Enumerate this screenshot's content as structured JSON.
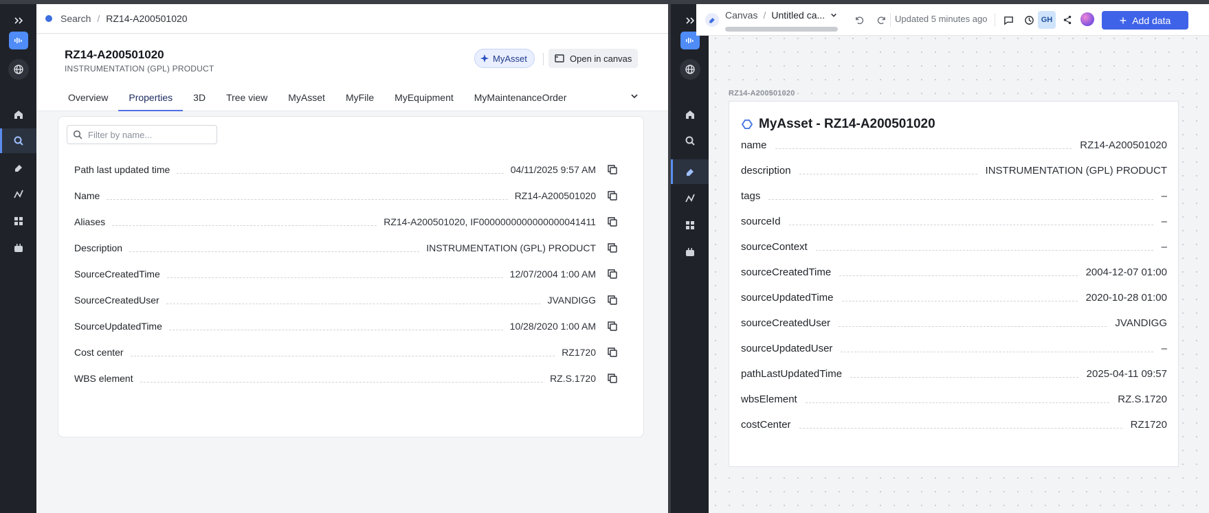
{
  "left": {
    "breadcrumb": {
      "root": "Search",
      "current": "RZ14-A200501020"
    },
    "asset": {
      "title": "RZ14-A200501020",
      "subtitle": "INSTRUMENTATION (GPL) PRODUCT"
    },
    "chip_label": "MyAsset",
    "open_canvas_label": "Open in canvas",
    "tabs": [
      "Overview",
      "Properties",
      "3D",
      "Tree view",
      "MyAsset",
      "MyFile",
      "MyEquipment",
      "MyMaintenanceOrder"
    ],
    "active_tab": "Properties",
    "filter_placeholder": "Filter by name...",
    "properties": [
      {
        "label": "Path last updated time",
        "value": "04/11/2025 9:57 AM"
      },
      {
        "label": "Name",
        "value": "RZ14-A200501020"
      },
      {
        "label": "Aliases",
        "value": "RZ14-A200501020, IF0000000000000000041411"
      },
      {
        "label": "Description",
        "value": "INSTRUMENTATION (GPL) PRODUCT"
      },
      {
        "label": "SourceCreatedTime",
        "value": "12/07/2004 1:00 AM"
      },
      {
        "label": "SourceCreatedUser",
        "value": "JVANDIGG"
      },
      {
        "label": "SourceUpdatedTime",
        "value": "10/28/2020 1:00 AM"
      },
      {
        "label": "Cost center",
        "value": "RZ1720"
      },
      {
        "label": "WBS element",
        "value": "RZ.S.1720"
      }
    ]
  },
  "right": {
    "toolbar": {
      "crumb_root": "Canvas",
      "canvas_title": "Untitled ca...",
      "updated": "Updated 5 minutes ago",
      "user_initials": "GH",
      "add_data_label": "Add data"
    },
    "card_label": "RZ14-A200501020",
    "card": {
      "title": "MyAsset - RZ14-A200501020",
      "rows": [
        {
          "label": "name",
          "value": "RZ14-A200501020"
        },
        {
          "label": "description",
          "value": "INSTRUMENTATION (GPL) PRODUCT"
        },
        {
          "label": "tags",
          "value": "–"
        },
        {
          "label": "sourceId",
          "value": "–"
        },
        {
          "label": "sourceContext",
          "value": "–"
        },
        {
          "label": "sourceCreatedTime",
          "value": "2004-12-07 01:00"
        },
        {
          "label": "sourceUpdatedTime",
          "value": "2020-10-28 01:00"
        },
        {
          "label": "sourceCreatedUser",
          "value": "JVANDIGG"
        },
        {
          "label": "sourceUpdatedUser",
          "value": "–"
        },
        {
          "label": "pathLastUpdatedTime",
          "value": "2025-04-11 09:57"
        },
        {
          "label": "wbsElement",
          "value": "RZ.S.1720"
        },
        {
          "label": "costCenter",
          "value": "RZ1720"
        }
      ]
    }
  },
  "colors": {
    "accent": "#3f63e8",
    "rail": "#1f2229",
    "chip": "#e9efff"
  }
}
